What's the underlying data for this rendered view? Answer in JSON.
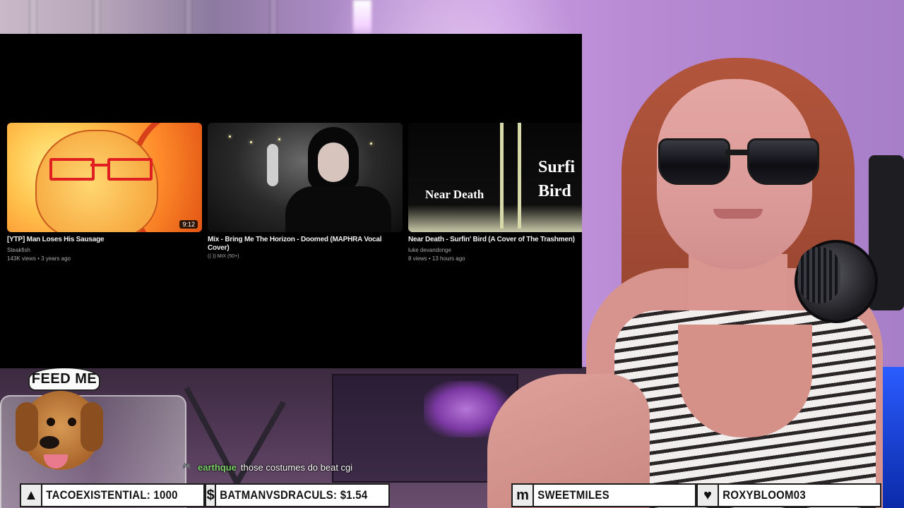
{
  "screen": {
    "videos": [
      {
        "title": "[YTP] Man Loses His Sausage",
        "channel": "Steakfish",
        "meta": "143K views • 3 years ago",
        "duration": "9:12"
      },
      {
        "title": "Mix - Bring Me The Horizon - Doomed (MAPHRA Vocal Cover)",
        "badge": "((·)) MIX (50+)"
      },
      {
        "title": "Near Death - Surfin' Bird (A Cover of The Trashmen)",
        "channel": "luke devandonge",
        "meta": "8 views • 13 hours ago",
        "thumb_text_left": "Near Death",
        "thumb_text_right": "Surfi\nBird"
      }
    ]
  },
  "sticker": {
    "text": "FEED ME"
  },
  "chat": {
    "badge_icon": "controller-icon",
    "username": "earthque",
    "message": "those costumes do beat cgi",
    "username_color": "#7dd36a"
  },
  "alerts": [
    {
      "icon": "diamond-up-icon",
      "glyph": "▲",
      "text": "TACOEXISTENTIAL: 1000"
    },
    {
      "icon": "dollar-icon",
      "glyph": "$",
      "text": "BATMANVSDRACULS: $1.54"
    },
    {
      "icon": "m-logo-icon",
      "glyph": "m",
      "text": "SWEETMILES"
    },
    {
      "icon": "heart-icon",
      "glyph": "♥",
      "text": "ROXYBLOOM03"
    }
  ]
}
